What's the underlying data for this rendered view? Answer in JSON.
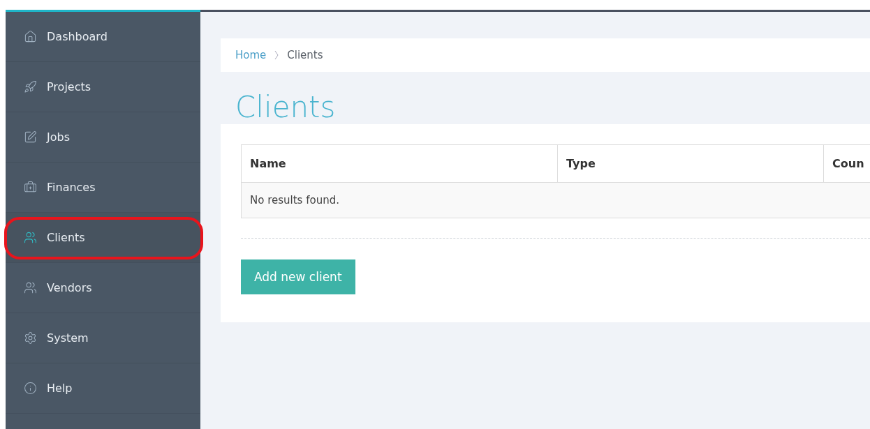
{
  "sidebar": {
    "items": [
      {
        "label": "Dashboard",
        "selected": false,
        "annotated": false
      },
      {
        "label": "Projects",
        "selected": false,
        "annotated": false
      },
      {
        "label": "Jobs",
        "selected": false,
        "annotated": false
      },
      {
        "label": "Finances",
        "selected": false,
        "annotated": false
      },
      {
        "label": "Clients",
        "selected": true,
        "annotated": true
      },
      {
        "label": "Vendors",
        "selected": false,
        "annotated": false
      },
      {
        "label": "System",
        "selected": false,
        "annotated": false
      },
      {
        "label": "Help",
        "selected": false,
        "annotated": false
      }
    ]
  },
  "breadcrumb": [
    {
      "label": "Home",
      "link": true
    },
    {
      "label": "Clients",
      "link": false
    }
  ],
  "page_title": "Clients",
  "table": {
    "columns": [
      "Name",
      "Type",
      "Coun"
    ],
    "empty_message": "No results found."
  },
  "buttons": [
    "Add new client"
  ]
}
